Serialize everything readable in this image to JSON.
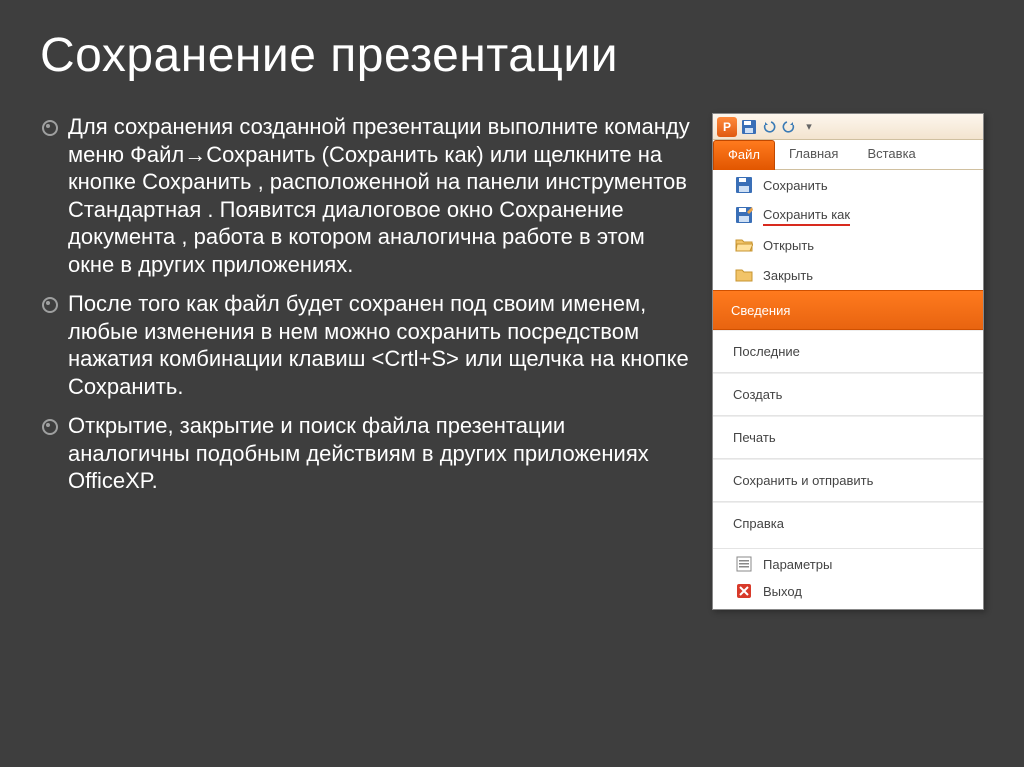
{
  "title": "Сохранение презентации",
  "bullets": [
    "Для сохранения созданной презентации выполните команду меню Файл→Сохранить (Сохранить как) или щелкните на кнопке Сохранить , расположенной на панели инструментов Стандартная . Появится диалоговое окно Сохранение документа , работа в котором аналогична работе в этом окне в других приложениях.",
    "После того как файл будет сохранен под своим именем, любые изменения в нем можно сохранить посредством нажатия комбинации клавиш <Crtl+S> или щелчка на кнопке Сохранить.",
    "Открытие, закрытие и поиск файла презентации аналогичны подобным действиям в других приложениях OfficeXP."
  ],
  "ribbon": {
    "tabs": [
      "Файл",
      "Главная",
      "Вставка"
    ],
    "active": 0
  },
  "file_menu": {
    "top": [
      {
        "icon": "save",
        "label": "Сохранить"
      },
      {
        "icon": "saveas",
        "label": "Сохранить как",
        "highlight": true
      },
      {
        "icon": "open",
        "label": "Открыть"
      },
      {
        "icon": "close",
        "label": "Закрыть"
      }
    ],
    "sections": [
      {
        "label": "Сведения",
        "active": true
      },
      {
        "label": "Последние"
      },
      {
        "label": "Создать"
      },
      {
        "label": "Печать"
      },
      {
        "label": "Сохранить и отправить"
      },
      {
        "label": "Справка"
      }
    ],
    "bottom": [
      {
        "icon": "options",
        "label": "Параметры"
      },
      {
        "icon": "exit",
        "label": "Выход"
      }
    ]
  }
}
